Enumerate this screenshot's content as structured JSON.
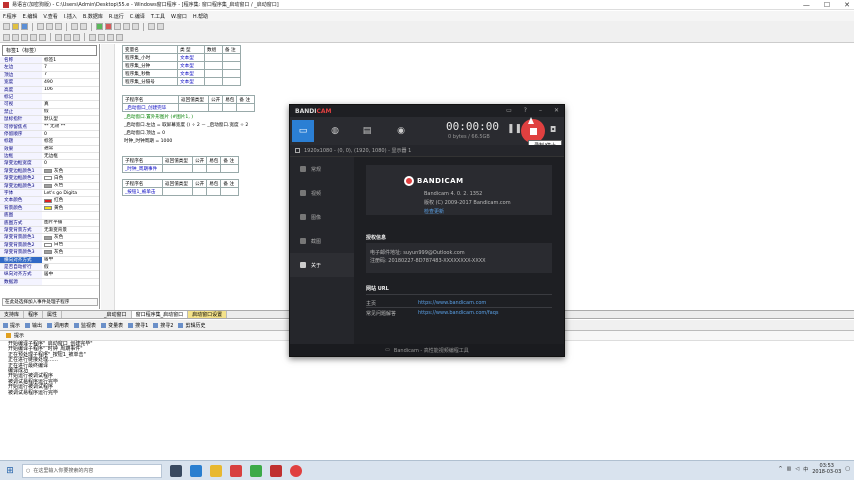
{
  "window": {
    "title": "易语言(加密狗版) - C:\\Users\\Admin\\Desktop\\55.e - Windows窗口程序 - [程序集: 窗口程序集_启动窗口 / _启动窗口]",
    "controls": [
      "—",
      "☐",
      "✕"
    ]
  },
  "menu": [
    "F.程序",
    "E.编辑",
    "V.查看",
    "I.插入",
    "B.数据库",
    "R.运行",
    "C.编译",
    "T.工具",
    "W.窗口",
    "H.帮助"
  ],
  "property_panel": {
    "selector": "标签1（标签）",
    "rows": [
      {
        "k": "名称",
        "v": "标签1"
      },
      {
        "k": "左边",
        "v": "7"
      },
      {
        "k": "顶边",
        "v": "7"
      },
      {
        "k": "宽度",
        "v": "490"
      },
      {
        "k": "高度",
        "v": "106"
      },
      {
        "k": "标记",
        "v": ""
      },
      {
        "k": "可视",
        "v": "真"
      },
      {
        "k": "禁止",
        "v": "假"
      },
      {
        "k": "鼠标指针",
        "v": "默认型"
      },
      {
        "k": "可停留焦点",
        "v": "** 无效 **"
      },
      {
        "k": "  停留顺序",
        "v": "0"
      },
      {
        "k": "标题",
        "v": "标签"
      },
      {
        "k": "效果",
        "v": "通常"
      },
      {
        "k": "边框",
        "v": "无边框"
      },
      {
        "k": "  渐变边框宽度",
        "v": "0"
      },
      {
        "k": "  渐变边框颜色1",
        "v": "灰色"
      },
      {
        "k": "  渐变边框颜色2",
        "v": "白色"
      },
      {
        "k": "  渐变边框颜色3",
        "v": "灰色"
      },
      {
        "k": "字体",
        "v": "Let's go Digita"
      },
      {
        "k": "文本颜色",
        "v": "红色"
      },
      {
        "k": "背景颜色",
        "v": "黄色"
      },
      {
        "k": "底图",
        "v": ""
      },
      {
        "k": "  底图方式",
        "v": "图片平铺"
      },
      {
        "k": "渐变背景方式",
        "v": "无渐变背景"
      },
      {
        "k": "  渐变背景颜色1",
        "v": "灰色"
      },
      {
        "k": "  渐变背景颜色2",
        "v": "白色"
      },
      {
        "k": "  渐变背景颜色3",
        "v": "灰色"
      },
      {
        "k": "横向对齐方式",
        "v": "居中"
      },
      {
        "k": "是否自动折行",
        "v": "假"
      },
      {
        "k": "纵向对齐方式",
        "v": "居中"
      },
      {
        "k": "数据源",
        "v": ""
      }
    ],
    "hint": "在此处选择加入事件处理子程序",
    "text_color": "#e02020",
    "bg_color": "#f0e020",
    "gray": "#a0a0a0",
    "white": "#ffffff"
  },
  "code": {
    "var_table_headers": [
      "变量名",
      "类 型",
      "数组",
      "备 注"
    ],
    "vars": [
      {
        "name": "程序集_小时",
        "type": "文本型"
      },
      {
        "name": "程序集_分钟",
        "type": "文本型"
      },
      {
        "name": "程序集_秒数",
        "type": "文本型"
      },
      {
        "name": "程序集_分隔号",
        "type": "文本型"
      }
    ],
    "sub1_headers": [
      "子程序名",
      "返回值类型",
      "公开",
      "易包",
      "备 注"
    ],
    "sub1_name": "_启动窗口_创建完毕",
    "sub1_lines": [
      "_启动窗口.置外形图片 (#图片1, )",
      "_启动窗口.左边 = 取屏幕宽度 () ÷ 2 － _启动窗口.宽度 ÷ 2",
      "_启动窗口.顶边 = 0",
      "时钟_时钟周期 = 1000"
    ],
    "sub2_headers": [
      "子程序名",
      "返回值类型",
      "公开",
      "易包",
      "备 注"
    ],
    "sub2_name": "_时钟_周期事件",
    "sub3_headers": [
      "子程序名",
      "返回值类型",
      "公开",
      "易包",
      "备 注"
    ],
    "sub3_name": "_按钮1_被单击"
  },
  "tabs": [
    "支持库",
    "程序",
    "属性",
    "_启动窗口",
    "窗口程序集_启动窗口",
    "启动窗口设置"
  ],
  "output": {
    "tabs": [
      "提示",
      "输出",
      "调用表",
      "监视表",
      "变量表",
      "搜寻1",
      "搜寻2",
      "剪辑历史"
    ],
    "lines": [
      "开始编译子程序\"_启动窗口_创建完毕\"",
      "开始编译子程序\"_时钟_周期事件\"",
      "正在预处理子程序\"_按钮1_被单击\"",
      "正在进行链接处理……",
      "正在进行最终编译",
      "编译成功",
      "开始运行被调试程序",
      "被调试易程序运行完毕",
      "开始运行被调试程序",
      "被调试易程序运行完毕"
    ]
  },
  "bandicam": {
    "title_a": "BANDI",
    "title_b": "CAM",
    "timer": "00:00:00",
    "size": "0 bytes / 66.5GB",
    "tooltip": "录制/停止",
    "subbar": "1920x1080 - (0, 0), (1920, 1080) - 显示器 1",
    "sidebar": [
      "常规",
      "视频",
      "图像",
      "截图",
      "关于"
    ],
    "logo_text": "BANDICAM",
    "version": "Bandicam 4. 0. 2. 1352",
    "copyright": "版权 (C) 2009-2017 Bandicam.com",
    "check_update": "检查更新",
    "license_title": "授权信息",
    "license_email": "电子邮件地址: suyun999@Outlook.com",
    "license_serial": "注册码: 20180227-8D787483-XXXXXXXX-XXXX",
    "website_title": "网站 URL",
    "homepage_label": "主页",
    "homepage_url": "https://www.bandicam.com",
    "faq_label": "常见问题解答",
    "faq_url": "https://www.bandicam.com/faqs",
    "footer": "Bandicam - 高性能视频编程工具",
    "accent": "#2b7fd4",
    "rec_color": "#e04040"
  },
  "taskbar": {
    "search_placeholder": "在这里输入你要搜索的内容",
    "time": "03:53",
    "date": "2018-03-03",
    "lang": "中"
  }
}
